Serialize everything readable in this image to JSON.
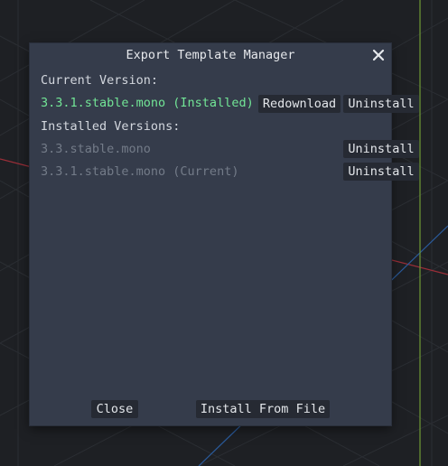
{
  "dialog": {
    "title": "Export Template Manager",
    "close_icon": "close-icon",
    "current_version_label": "Current Version:",
    "current_version_value": "3.3.1.stable.mono (Installed)",
    "redownload_label": "Redownload",
    "uninstall_label": "Uninstall",
    "installed_versions_label": "Installed Versions:",
    "installed_versions": [
      {
        "name": "3.3.stable.mono",
        "uninstall_label": "Uninstall"
      },
      {
        "name": "3.3.1.stable.mono (Current)",
        "uninstall_label": "Uninstall"
      }
    ],
    "close_label": "Close",
    "install_from_file_label": "Install From File"
  },
  "colors": {
    "dialog_bg": "#353c4b",
    "button_bg": "#262a33",
    "installed_text": "#72e596",
    "dim_text": "#737b88",
    "viewport_bg": "#1e2024",
    "axis_red": "#a0303a",
    "axis_blue": "#2a5a9a",
    "axis_green": "#7fa33a"
  }
}
